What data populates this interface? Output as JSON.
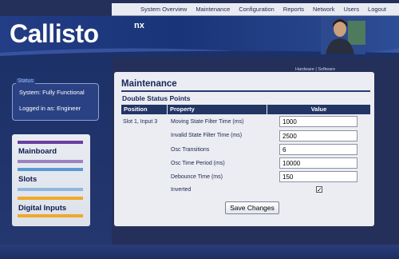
{
  "nav": {
    "items": [
      "System Overview",
      "Maintenance",
      "Configuration",
      "Reports",
      "Network",
      "Users",
      "Logout"
    ]
  },
  "brand": {
    "name": "Callisto",
    "suffix": "nx"
  },
  "status": {
    "title": "Status",
    "system": "System: Fully Functional",
    "login": "Logged in as: Engineer"
  },
  "sidebar": {
    "items": [
      {
        "label": "Mainboard",
        "bar_color": "#6a3fa0"
      },
      {
        "label": "Slots",
        "bar_color": "#5a9ad4"
      },
      {
        "label": "Digital Inputs",
        "bar_color": "#f0a92a"
      }
    ]
  },
  "tabs": {
    "hardware": "Hardware",
    "separator": "|",
    "software": "Software"
  },
  "main": {
    "title": "Maintenance",
    "section": "Double Status Points",
    "columns": {
      "position": "Position",
      "property": "Property",
      "value": "Value"
    },
    "position_value": "Slot 1, Input 3",
    "rows": [
      {
        "property": "Moving State Filter Time (ms)",
        "value": "1000"
      },
      {
        "property": "Invalid State Filter Time (ms)",
        "value": "2500"
      },
      {
        "property": "Osc Transitions",
        "value": "6"
      },
      {
        "property": "Osc Time Period (ms)",
        "value": "10000"
      },
      {
        "property": "Debounce Time (ms)",
        "value": "150"
      }
    ],
    "inverted_label": "Inverted",
    "inverted_checked": true,
    "save_label": "Save Changes"
  },
  "colors": {
    "accent": "#233565",
    "background": "#24305a"
  }
}
